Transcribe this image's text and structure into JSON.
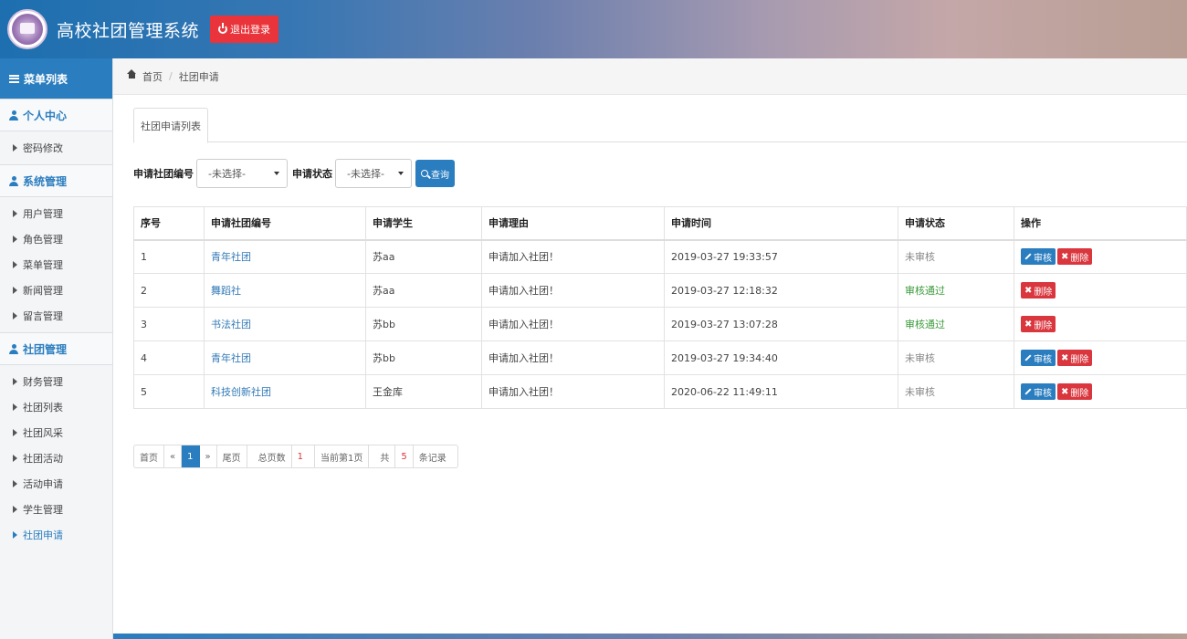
{
  "header": {
    "title": "高校社团管理系统",
    "logout_label": "退出登录"
  },
  "sidebar": {
    "menu_header": "菜单列表",
    "sections": [
      {
        "label": "个人中心",
        "items": [
          "密码修改"
        ]
      },
      {
        "label": "系统管理",
        "items": [
          "用户管理",
          "角色管理",
          "菜单管理",
          "新闻管理",
          "留言管理"
        ]
      },
      {
        "label": "社团管理",
        "items": [
          "财务管理",
          "社团列表",
          "社团风采",
          "社团活动",
          "活动申请",
          "学生管理",
          "社团申请"
        ]
      }
    ],
    "active_item": "社团申请"
  },
  "breadcrumb": {
    "home": "首页",
    "current": "社团申请"
  },
  "tab": {
    "label": "社团申请列表"
  },
  "filter": {
    "club_label": "申请社团编号",
    "club_select": "-未选择-",
    "status_label": "申请状态",
    "status_select": "-未选择-",
    "query_label": "查询"
  },
  "table": {
    "headers": [
      "序号",
      "申请社团编号",
      "申请学生",
      "申请理由",
      "申请时间",
      "申请状态",
      "操作"
    ],
    "rows": [
      {
        "no": "1",
        "club": "青年社团",
        "student": "苏aa",
        "reason": "申请加入社团！",
        "time": "2019-03-27 19:33:57",
        "status": "未审核"
      },
      {
        "no": "2",
        "club": "舞蹈社",
        "student": "苏aa",
        "reason": "申请加入社团！",
        "time": "2019-03-27 12:18:32",
        "status": "审核通过"
      },
      {
        "no": "3",
        "club": "书法社团",
        "student": "苏bb",
        "reason": "申请加入社团！",
        "time": "2019-03-27 13:07:28",
        "status": "审核通过"
      },
      {
        "no": "4",
        "club": "青年社团",
        "student": "苏bb",
        "reason": "申请加入社团！",
        "time": "2019-03-27 19:34:40",
        "status": "未审核"
      },
      {
        "no": "5",
        "club": "科技创新社团",
        "student": "王金库",
        "reason": "申请加入社团！",
        "time": "2020-06-22 11:49:11",
        "status": "未审核"
      }
    ],
    "audit_label": "审核",
    "delete_label": "删除"
  },
  "pager": {
    "first": "首页",
    "prev": "«",
    "page": "1",
    "next": "»",
    "last": "尾页",
    "total_pages_label": "总页数",
    "total_pages": "1",
    "current_page_text": "当前第1页",
    "records_prefix": "共",
    "records_count": "5",
    "records_suffix": "条记录"
  },
  "colors": {
    "primary": "#2a7dbf",
    "danger": "#d9363e",
    "success": "#3c9a3c"
  }
}
